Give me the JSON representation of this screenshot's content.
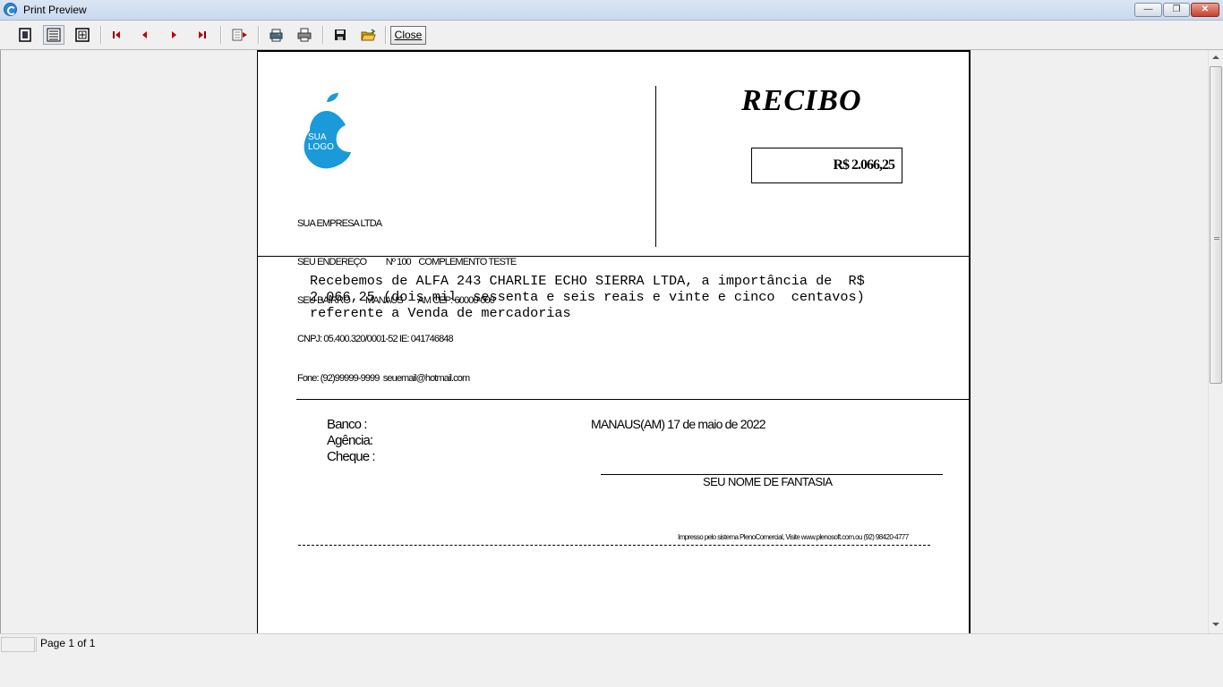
{
  "window": {
    "title": "Print Preview"
  },
  "toolbar": {
    "icons": [
      "one-page-icon",
      "page-width-icon",
      "full-page-icon",
      "first-page-icon",
      "previous-page-icon",
      "next-page-icon",
      "last-page-icon",
      "go-to-page-icon",
      "printer-setup-icon",
      "print-icon",
      "save-icon",
      "open-icon"
    ],
    "close_label": "Close"
  },
  "receipt": {
    "title": "RECIBO",
    "amount": "R$ 2.066,25",
    "logo": {
      "line1": "SUA",
      "line2": "LOGO",
      "color": "#1a9ad9"
    },
    "company_lines": [
      "SUA EMPRESA LTDA",
      "SEU ENDEREÇO          Nº 100    COMPLEMENTO TESTE",
      "SEU BAIRRO        MANAUS        AM CEP: 60000-000",
      "CNPJ: 05.400.320/0001-52 IE: 041746848",
      "Fone: (92)99999-9999  seuemail@hotmail.com"
    ],
    "body_lines": [
      "Recebemos de ALFA 243 CHARLIE ECHO SIERRA LTDA, a importância de  R$",
      "2.066,25 (dois mil, sessenta e seis reais e vinte e cinco  centavos)",
      "referente a Venda de mercadorias"
    ],
    "bank_label": "Banco  :",
    "agency_label": "Agência:",
    "check_label": "Cheque :",
    "place_date": "MANAUS(AM) 17 de maio de 2022",
    "signature_name": "SEU NOME DE FANTASIA",
    "footnote": "Impresso pelo sistema PlenoComercial, Visite www.plenosoft.com.ou (92) 98420-4777"
  },
  "status": {
    "page_info": "Page 1 of 1"
  }
}
